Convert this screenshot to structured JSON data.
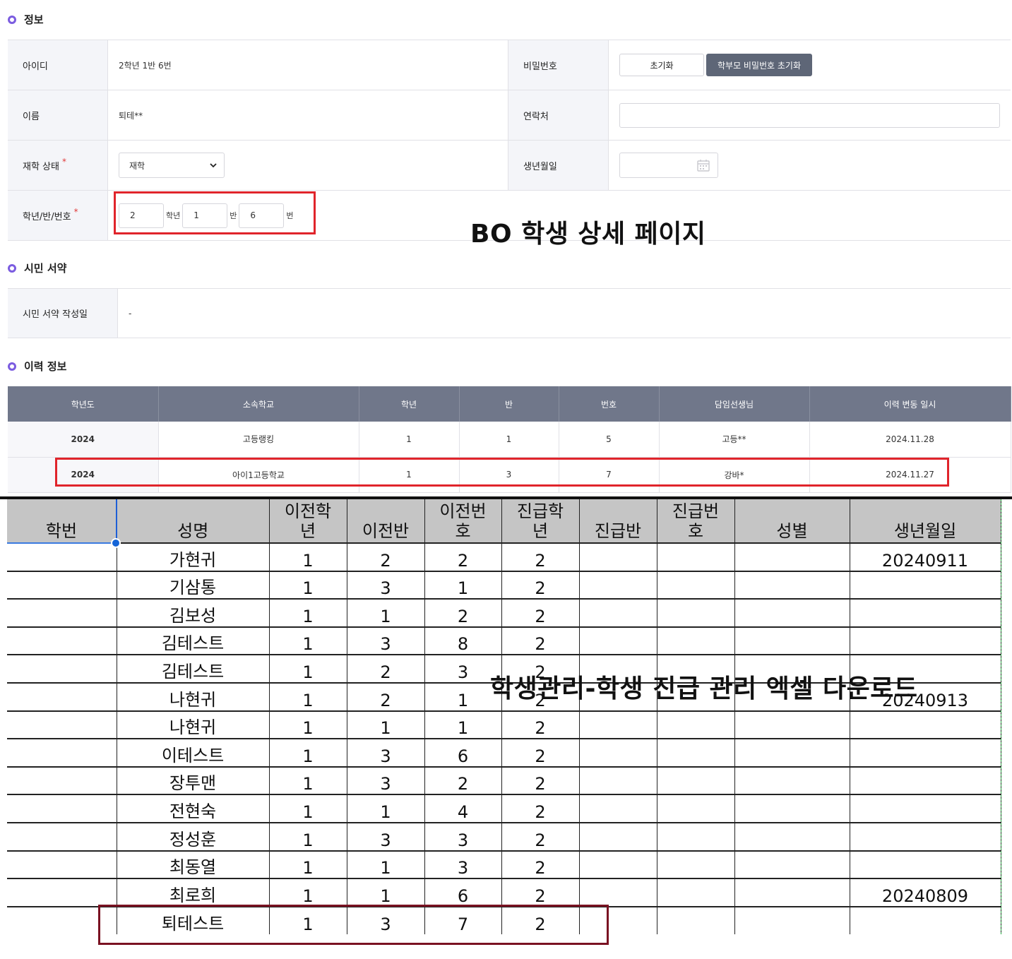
{
  "sections": {
    "info": "정보",
    "pledge": "시민 서약",
    "history": "이력 정보"
  },
  "info_form": {
    "id_label": "아이디",
    "id_value": "2학년 1반 6번",
    "password_label": "비밀번호",
    "reset_button": "초기화",
    "parent_reset_button": "학부모 비밀번호 초기화",
    "name_label": "이름",
    "name_value": "퇴테**",
    "contact_label": "연락처",
    "contact_value": "",
    "status_label": "재학 상태",
    "status_value": "재학",
    "birth_label": "생년월일",
    "birth_value": "",
    "grade_label": "학년/반/번호",
    "required_mark": "*",
    "grade_value": "2",
    "grade_unit": "학년",
    "class_value": "1",
    "class_unit": "반",
    "number_value": "6",
    "number_unit": "번"
  },
  "pledge": {
    "label": "시민 서약 작성일",
    "value": "-"
  },
  "overlay_titles": {
    "bo": "BO 학생 상세 페이지",
    "excel": "학생관리-학생 진급 관리 엑셀 다운로드"
  },
  "history_table": {
    "headers": [
      "학년도",
      "소속학교",
      "학년",
      "반",
      "번호",
      "담임선생님",
      "이력 변동 일시"
    ],
    "rows": [
      [
        "2024",
        "고등랭킹",
        "1",
        "1",
        "5",
        "고등**",
        "2024.11.28"
      ],
      [
        "2024",
        "아이1고등학교",
        "1",
        "3",
        "7",
        "강바*",
        "2024.11.27"
      ]
    ]
  },
  "sheet": {
    "headers": [
      "학번",
      "성명",
      "이전학\n년",
      "이전반",
      "이전번\n호",
      "진급학\n년",
      "진급반",
      "진급번\n호",
      "성별",
      "생년월일"
    ],
    "rows": [
      [
        "",
        "가현귀",
        "1",
        "2",
        "2",
        "2",
        "",
        "",
        "",
        "20240911"
      ],
      [
        "",
        "기삼통",
        "1",
        "3",
        "1",
        "2",
        "",
        "",
        "",
        ""
      ],
      [
        "",
        "김보성",
        "1",
        "1",
        "2",
        "2",
        "",
        "",
        "",
        ""
      ],
      [
        "",
        "김테스트",
        "1",
        "3",
        "8",
        "2",
        "",
        "",
        "",
        ""
      ],
      [
        "",
        "김테스트",
        "1",
        "2",
        "3",
        "2",
        "",
        "",
        "",
        ""
      ],
      [
        "",
        "나현귀",
        "1",
        "2",
        "1",
        "2",
        "",
        "",
        "",
        "20240913"
      ],
      [
        "",
        "나현귀",
        "1",
        "1",
        "1",
        "2",
        "",
        "",
        "",
        ""
      ],
      [
        "",
        "이테스트",
        "1",
        "3",
        "6",
        "2",
        "",
        "",
        "",
        ""
      ],
      [
        "",
        "장투맨",
        "1",
        "3",
        "2",
        "2",
        "",
        "",
        "",
        ""
      ],
      [
        "",
        "전현숙",
        "1",
        "1",
        "4",
        "2",
        "",
        "",
        "",
        ""
      ],
      [
        "",
        "정성훈",
        "1",
        "3",
        "3",
        "2",
        "",
        "",
        "",
        ""
      ],
      [
        "",
        "최동열",
        "1",
        "1",
        "3",
        "2",
        "",
        "",
        "",
        ""
      ],
      [
        "",
        "최로희",
        "1",
        "1",
        "6",
        "2",
        "",
        "",
        "",
        "20240809"
      ],
      [
        "",
        "퇴테스트",
        "1",
        "3",
        "7",
        "2",
        "",
        "",
        "",
        ""
      ]
    ]
  },
  "colors": {
    "accent": "#7b5ce0",
    "highlight_red": "#e0242b",
    "highlight_maroon": "#7a1222",
    "table_header": "#70778a",
    "dark_button": "#5e6677"
  }
}
